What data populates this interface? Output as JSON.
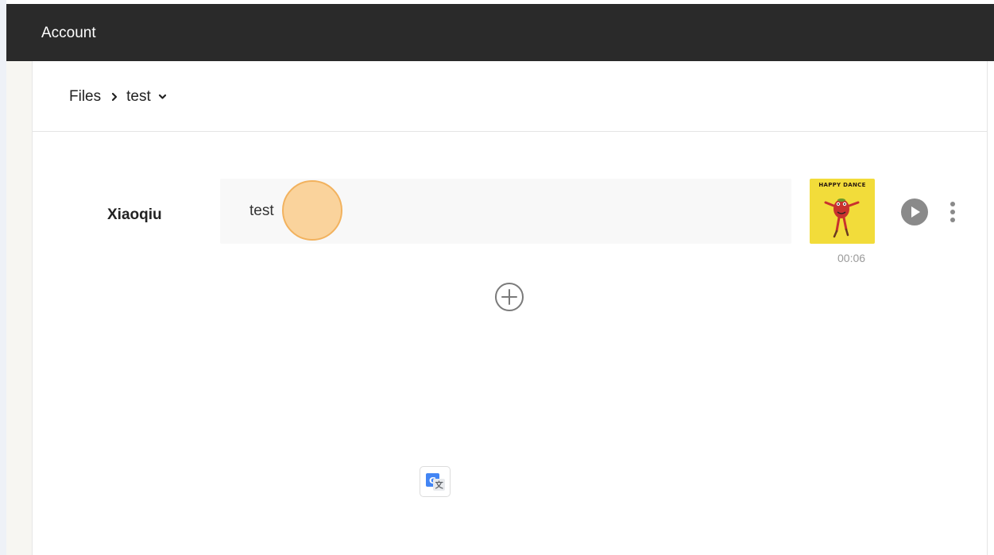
{
  "header": {
    "title": "Account"
  },
  "breadcrumb": {
    "root_label": "Files",
    "current_label": "test",
    "separator_icon": "chevron-right-icon",
    "dropdown_icon": "chevron-down-icon"
  },
  "track": {
    "speaker": "Xiaoqiu",
    "text": "test",
    "thumbnail_caption": "HAPPY DANCE",
    "duration": "00:06",
    "play_icon": "play-circle-icon",
    "more_icon": "more-vertical-icon"
  },
  "actions": {
    "add_icon": "plus-circle-icon",
    "translate_icon": "google-translate-icon"
  },
  "colors": {
    "top_bar": "#2a2a2a",
    "highlight_fill": "#fac882",
    "highlight_border": "#f2b25e",
    "thumbnail_bg": "#f2dc3a",
    "muted_icon": "#8a8a8a"
  }
}
